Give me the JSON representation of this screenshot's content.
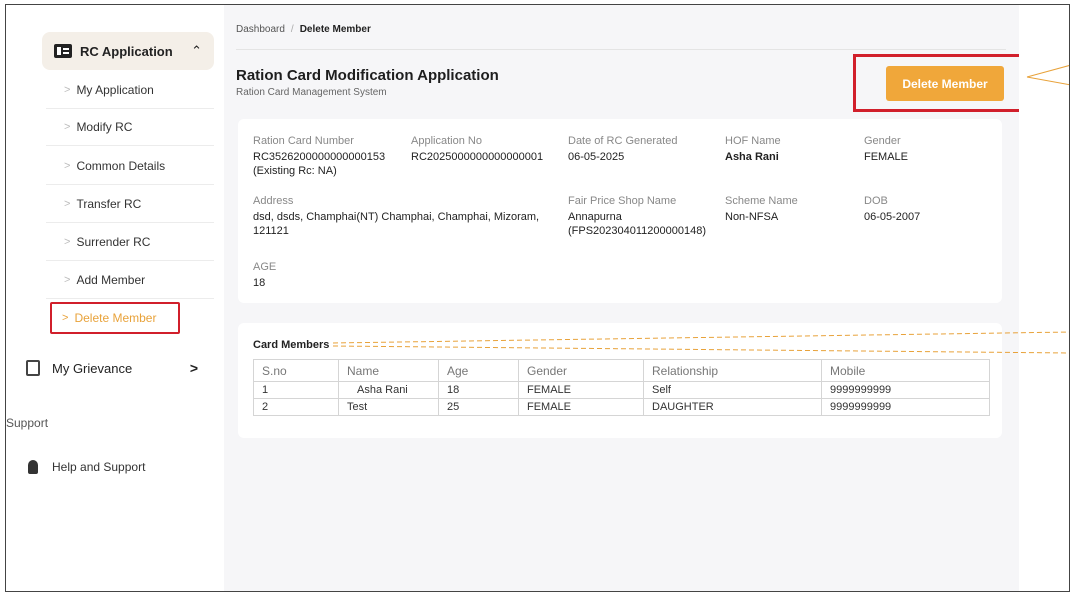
{
  "sidebar": {
    "rc_application": "RC Application",
    "items": [
      {
        "label": "My Application"
      },
      {
        "label": "Modify RC"
      },
      {
        "label": "Common Details"
      },
      {
        "label": "Transfer RC"
      },
      {
        "label": "Surrender RC"
      },
      {
        "label": "Add Member"
      },
      {
        "label": "Delete Member"
      }
    ],
    "grievance": "My Grievance",
    "support": "Support",
    "help": "Help and Support"
  },
  "breadcrumb": {
    "home": "Dashboard",
    "current": "Delete Member"
  },
  "page": {
    "title": "Ration Card Modification Application",
    "subtitle": "Ration Card Management System",
    "delete_button": "Delete Member"
  },
  "info": {
    "rc_number": {
      "label": "Ration Card Number",
      "value": "RC3526200000000000153",
      "note": "(Existing Rc: NA)"
    },
    "application_no": {
      "label": "Application No",
      "value": "RC2025000000000000001"
    },
    "date_generated": {
      "label": "Date of RC Generated",
      "value": "06-05-2025"
    },
    "hof_name": {
      "label": "HOF Name",
      "value": "Asha Rani"
    },
    "gender": {
      "label": "Gender",
      "value": "FEMALE"
    },
    "address": {
      "label": "Address",
      "value": "dsd, dsds, Champhai(NT) Champhai, Champhai, Mizoram,",
      "value2": "121121"
    },
    "fps_name": {
      "label": "Fair Price Shop Name",
      "value": "Annapurna",
      "value2": "(FPS202304011200000148)"
    },
    "scheme": {
      "label": "Scheme Name",
      "value": "Non-NFSA"
    },
    "dob": {
      "label": "DOB",
      "value": "06-05-2007"
    },
    "age": {
      "label": "AGE",
      "value": "18"
    }
  },
  "members": {
    "title": "Card Members",
    "columns": [
      "S.no",
      "Name",
      "Age",
      "Gender",
      "Relationship",
      "Mobile"
    ],
    "rows": [
      [
        "1",
        "Asha Rani",
        "18",
        "FEMALE",
        "Self",
        "9999999999"
      ],
      [
        "2",
        "Test",
        "25",
        "FEMALE",
        "DAUGHTER",
        "9999999999"
      ]
    ]
  },
  "colors": {
    "accent": "#f0a73a",
    "highlight": "#d11f2b"
  }
}
